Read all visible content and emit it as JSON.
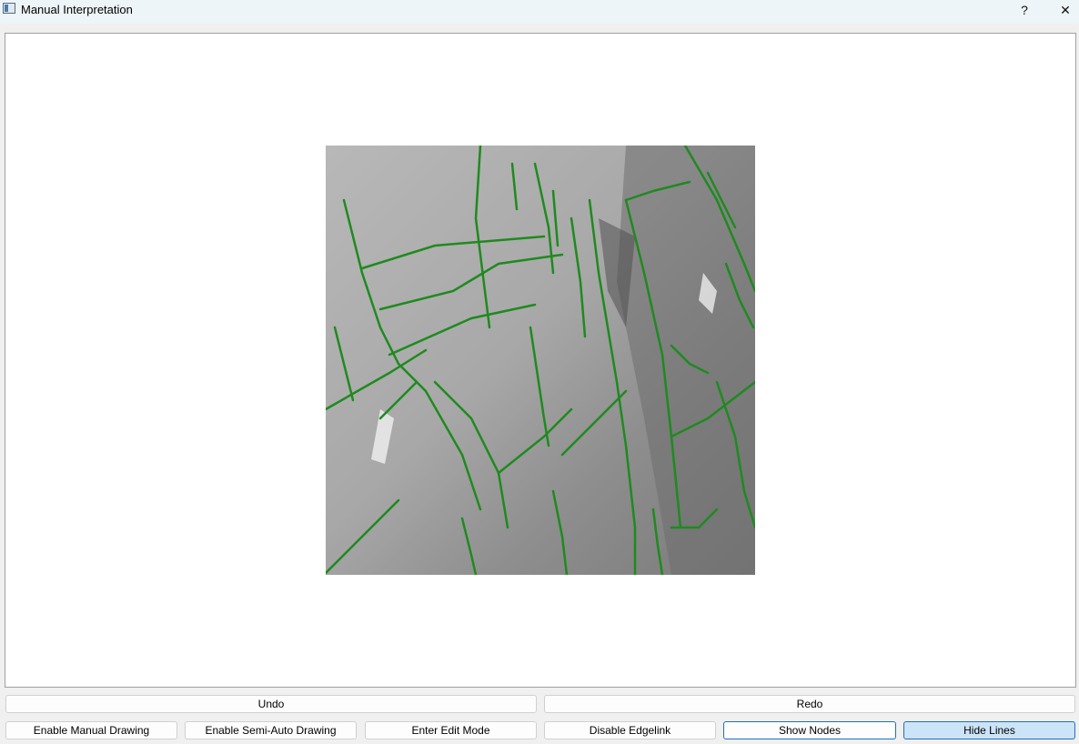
{
  "window": {
    "title": "Manual Interpretation",
    "help_label": "?",
    "close_label": "✕"
  },
  "toolbar_row1": {
    "undo_label": "Undo",
    "redo_label": "Redo"
  },
  "toolbar_row2": {
    "manual_label": "Enable Manual Drawing",
    "semi_auto_label": "Enable Semi-Auto Drawing",
    "edit_label": "Enter Edit Mode",
    "edgelink_label": "Disable Edgelink",
    "nodes_label": "Show Nodes",
    "lines_label": "Hide Lines"
  },
  "colors": {
    "overlay_lines": "#1f8a1f",
    "accent": "#1f6fc0"
  }
}
